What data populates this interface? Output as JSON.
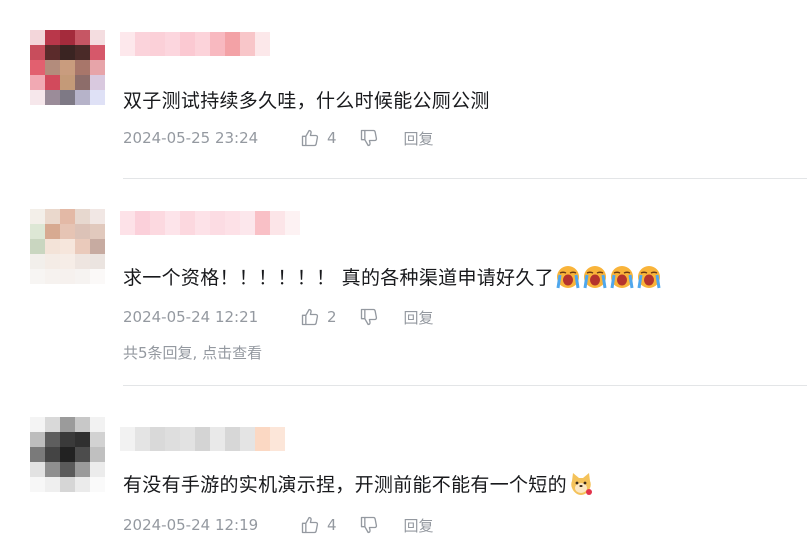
{
  "comments": [
    {
      "text": "双子测试持续多久哇，什么时候能公厕公测",
      "time": "2024-05-25 23:24",
      "likes": "4",
      "reply_label": "回复",
      "emoji": [],
      "sub_replies": ""
    },
    {
      "text": "求一个资格！！！！！！ 真的各种渠道申请好久了",
      "time": "2024-05-24 12:21",
      "likes": "2",
      "reply_label": "回复",
      "emoji": [
        "crying-emoji",
        "crying-emoji",
        "crying-emoji",
        "crying-emoji"
      ],
      "sub_replies": "共5条回复, 点击查看"
    },
    {
      "text": "有没有手游的实机演示捏，开测前能不能有一个短的",
      "time": "2024-05-24 12:19",
      "likes": "4",
      "reply_label": "回复",
      "emoji": [
        "doge-emoji"
      ],
      "sub_replies": ""
    }
  ],
  "colors": {
    "meta_text": "#9499a0",
    "divider": "#e3e5e7",
    "body_text": "#18191c"
  },
  "icons": [
    "thumbs-up-icon",
    "thumbs-down-icon",
    "crying-emoji",
    "doge-emoji"
  ]
}
